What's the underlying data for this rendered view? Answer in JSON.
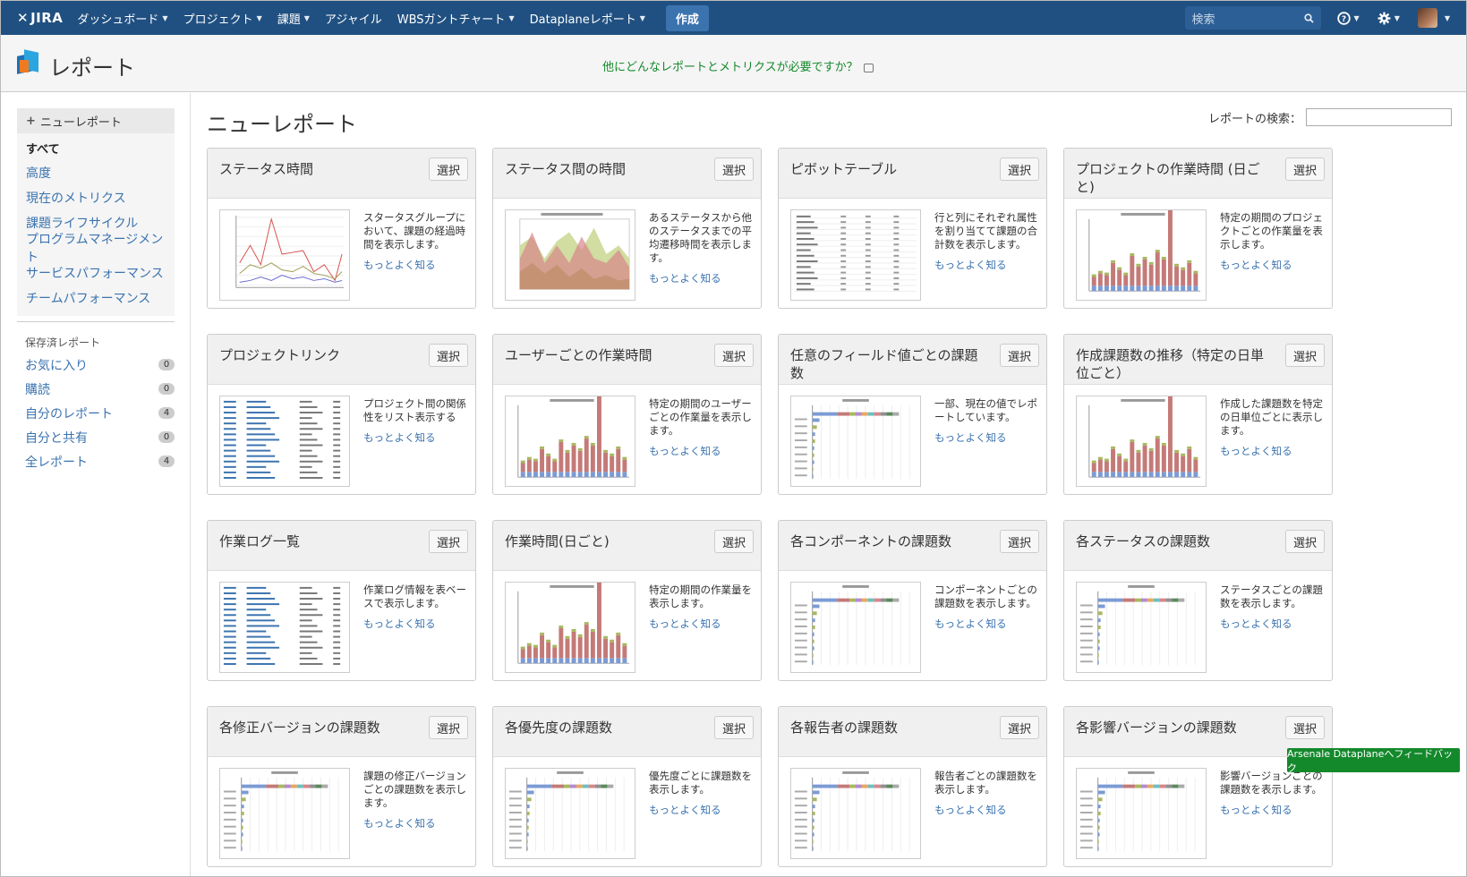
{
  "nav": {
    "logo": "JIRA",
    "items": [
      {
        "label": "ダッシュボード",
        "dropdown": true
      },
      {
        "label": "プロジェクト",
        "dropdown": true
      },
      {
        "label": "課題",
        "dropdown": true
      },
      {
        "label": "アジャイル",
        "dropdown": false
      },
      {
        "label": "WBSガントチャート",
        "dropdown": true
      },
      {
        "label": "Dataplaneレポート",
        "dropdown": true
      }
    ],
    "create_label": "作成",
    "search_placeholder": "検索",
    "help_icon": "help-icon",
    "settings_icon": "gear-icon"
  },
  "header": {
    "title": "レポート",
    "feedback_link": "他にどんなレポートとメトリクスが必要ですか？"
  },
  "sidebar": {
    "new_report": "ニューレポート",
    "items": [
      {
        "label": "すべて",
        "active": true
      },
      {
        "label": "高度",
        "active": false
      },
      {
        "label": "現在のメトリクス",
        "active": false
      },
      {
        "label": "課題ライフサイクル",
        "active": false
      },
      {
        "label": "プログラムマネージメント",
        "active": false
      },
      {
        "label": "サービスパフォーマンス",
        "active": false
      },
      {
        "label": "チームパフォーマンス",
        "active": false
      }
    ],
    "saved_title": "保存済レポート",
    "saved": [
      {
        "label": "お気に入り",
        "count": "0"
      },
      {
        "label": "購読",
        "count": "0"
      },
      {
        "label": "自分のレポート",
        "count": "4"
      },
      {
        "label": "自分と共有",
        "count": "0"
      },
      {
        "label": "全レポート",
        "count": "4"
      }
    ]
  },
  "main": {
    "title": "ニューレポート",
    "search_label": "レポートの検索：",
    "select_label": "選択",
    "more_label": "もっとよく知る",
    "cards": [
      {
        "title": "ステータス時間",
        "desc": "スタータスグループにおいて、課題の経過時間を表示します。",
        "thumb": "line"
      },
      {
        "title": "ステータス間の時間",
        "desc": "あるステータスから他のステータスまでの平均遷移時間を表示します。",
        "thumb": "area"
      },
      {
        "title": "ピボットテーブル",
        "desc": "行と列にそれぞれ属性を割り当てて課題の合計数を表示します。",
        "thumb": "table"
      },
      {
        "title": "プロジェクトの作業時間 (日ごと)",
        "desc": "特定の期間のプロジェクトごとの作業量を表示します。",
        "thumb": "bar"
      },
      {
        "title": "プロジェクトリンク",
        "desc": "プロジェクト間の関係性をリスト表示する",
        "thumb": "list"
      },
      {
        "title": "ユーザーごとの作業時間",
        "desc": "特定の期間のユーザーごとの作業量を表示します。",
        "thumb": "bar"
      },
      {
        "title": "任意のフィールド値ごとの課題数",
        "desc": "一部、現在の値でレポートしています。",
        "thumb": "hbar"
      },
      {
        "title": "作成課題数の推移（特定の日単位ごと）",
        "desc": "作成した課題数を特定の日単位ごとに表示します。",
        "thumb": "bar"
      },
      {
        "title": "作業ログ一覧",
        "desc": "作業ログ情報を表ベースで表示します。",
        "thumb": "list"
      },
      {
        "title": "作業時間(日ごと)",
        "desc": "特定の期間の作業量を表示します。",
        "thumb": "bar"
      },
      {
        "title": "各コンポーネントの課題数",
        "desc": "コンポーネントごとの課題数を表示します。",
        "thumb": "hbar"
      },
      {
        "title": "各ステータスの課題数",
        "desc": "ステータスごとの課題数を表示します。",
        "thumb": "hbar"
      },
      {
        "title": "各修正バージョンの課題数",
        "desc": "課題の修正バージョンごとの課題数を表示します。",
        "thumb": "hbar"
      },
      {
        "title": "各優先度の課題数",
        "desc": "優先度ごとに課題数を表示します。",
        "thumb": "hbar"
      },
      {
        "title": "各報告者の課題数",
        "desc": "報告者ごとの課題数を表示します。",
        "thumb": "hbar"
      },
      {
        "title": "各影響バージョンの課題数",
        "desc": "影響バージョンごとの課題数を表示します。",
        "thumb": "hbar"
      }
    ]
  },
  "feedback_button": "Arsenale Dataplaneへフィードバック",
  "colors": {
    "nav": "#205081",
    "link": "#3b73af",
    "green": "#14892c"
  }
}
